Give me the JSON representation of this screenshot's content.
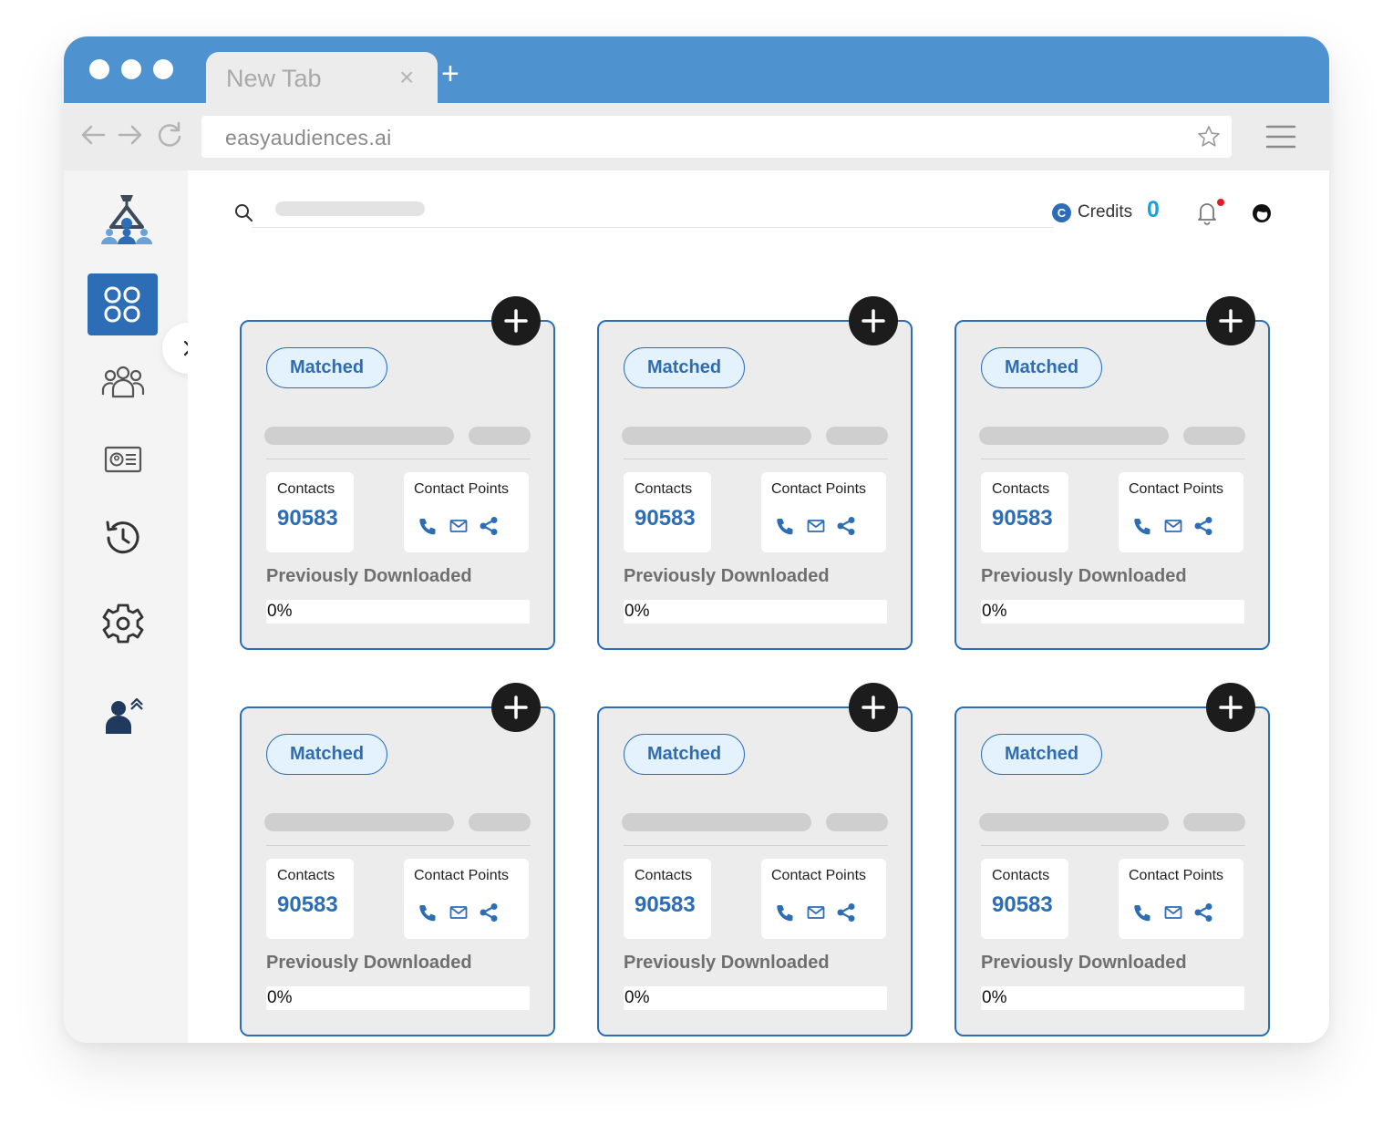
{
  "browser": {
    "tab_title": "New Tab",
    "tab_close": "×",
    "new_tab": "+",
    "url": "easyaudiences.ai",
    "icons": [
      "back-arrow-icon",
      "forward-arrow-icon",
      "reload-icon",
      "bookmark-star-icon",
      "hamburger-menu-icon"
    ]
  },
  "sidebar": {
    "items": [
      {
        "name": "logo",
        "icon": "logo-icon"
      },
      {
        "name": "dashboard",
        "icon": "grid-icon",
        "active": true
      },
      {
        "name": "audiences",
        "icon": "users-group-icon"
      },
      {
        "name": "contacts",
        "icon": "id-card-icon"
      },
      {
        "name": "history",
        "icon": "history-icon"
      },
      {
        "name": "settings",
        "icon": "gear-icon"
      },
      {
        "name": "account",
        "icon": "user-upgrade-icon"
      }
    ],
    "expand_icon": "chevron-right-icon"
  },
  "header": {
    "search_icon": "search-icon",
    "credits_badge": "C",
    "credits_label": "Credits",
    "credits_value": "0",
    "bell_icon": "bell-icon",
    "avatar_icon": "avatar-icon"
  },
  "colors": {
    "brand": "#2c6db5",
    "titlebar": "#4e93d0",
    "credits_value": "#1ba1e2",
    "notification_dot": "#e31b23"
  },
  "cards": [
    {
      "badge": "Matched",
      "contacts_label": "Contacts",
      "contacts_value": "90583",
      "contact_points_label": "Contact Points",
      "previously_downloaded_label": "Previously Downloaded",
      "progress_text": "0%",
      "progress": 0
    },
    {
      "badge": "Matched",
      "contacts_label": "Contacts",
      "contacts_value": "90583",
      "contact_points_label": "Contact Points",
      "previously_downloaded_label": "Previously Downloaded",
      "progress_text": "0%",
      "progress": 0
    },
    {
      "badge": "Matched",
      "contacts_label": "Contacts",
      "contacts_value": "90583",
      "contact_points_label": "Contact Points",
      "previously_downloaded_label": "Previously Downloaded",
      "progress_text": "0%",
      "progress": 0
    },
    {
      "badge": "Matched",
      "contacts_label": "Contacts",
      "contacts_value": "90583",
      "contact_points_label": "Contact Points",
      "previously_downloaded_label": "Previously Downloaded",
      "progress_text": "0%",
      "progress": 0
    },
    {
      "badge": "Matched",
      "contacts_label": "Contacts",
      "contacts_value": "90583",
      "contact_points_label": "Contact Points",
      "previously_downloaded_label": "Previously Downloaded",
      "progress_text": "0%",
      "progress": 0
    },
    {
      "badge": "Matched",
      "contacts_label": "Contacts",
      "contacts_value": "90583",
      "contact_points_label": "Contact Points",
      "previously_downloaded_label": "Previously Downloaded",
      "progress_text": "0%",
      "progress": 0
    }
  ]
}
